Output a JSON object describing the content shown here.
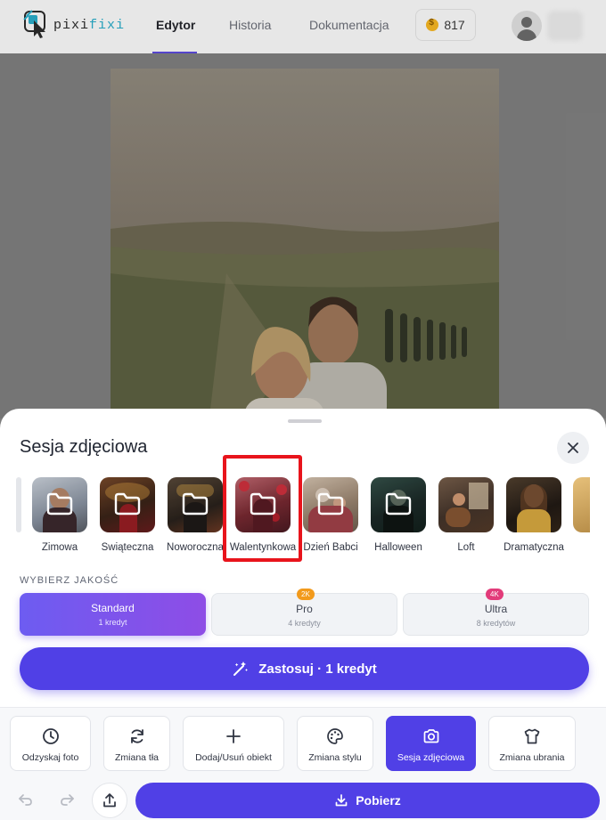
{
  "app": {
    "logo_text_a": "pixi",
    "logo_text_b": "fixi"
  },
  "nav": {
    "tabs": [
      {
        "label": "Edytor",
        "active": true
      },
      {
        "label": "Historia",
        "active": false
      },
      {
        "label": "Dokumentacja",
        "active": false
      }
    ],
    "credits": "817"
  },
  "sheet": {
    "title": "Sesja zdjęciowa",
    "presets": [
      {
        "label": "Zimowa",
        "icon": "folder-icon"
      },
      {
        "label": "Świąteczna",
        "icon": "folder-icon"
      },
      {
        "label": "Noworoczna",
        "icon": "folder-icon"
      },
      {
        "label": "Walentynkowa",
        "icon": "folder-icon",
        "highlighted": true
      },
      {
        "label": "Dzień Babci",
        "icon": "folder-icon"
      },
      {
        "label": "Halloween",
        "icon": "folder-icon"
      },
      {
        "label": "Loft",
        "icon": "folder-icon"
      },
      {
        "label": "Dramatyczna",
        "icon": "folder-icon"
      }
    ],
    "quality": {
      "label": "WYBIERZ JAKOŚĆ",
      "options": [
        {
          "name": "Standard",
          "sub": "1 kredyt",
          "selected": true
        },
        {
          "name": "Pro",
          "sub": "4 kredyty",
          "badge": "2K"
        },
        {
          "name": "Ultra",
          "sub": "8 kredytów",
          "badge": "4K"
        }
      ]
    },
    "apply_label": "Zastosuj · 1 kredyt"
  },
  "tools": [
    {
      "label": "Odzyskaj foto",
      "icon": "clock-icon"
    },
    {
      "label": "Zmiana tła",
      "icon": "refresh-icon"
    },
    {
      "label": "Dodaj/Usuń obiekt",
      "icon": "plus-icon"
    },
    {
      "label": "Zmiana stylu",
      "icon": "palette-icon"
    },
    {
      "label": "Sesja zdjęciowa",
      "icon": "camera-icon",
      "active": true
    },
    {
      "label": "Zmiana ubrania",
      "icon": "shirt-icon"
    }
  ],
  "bottom": {
    "download_label": "Pobierz"
  },
  "colors": {
    "accent": "#5040e6",
    "highlight": "#e8141c"
  }
}
